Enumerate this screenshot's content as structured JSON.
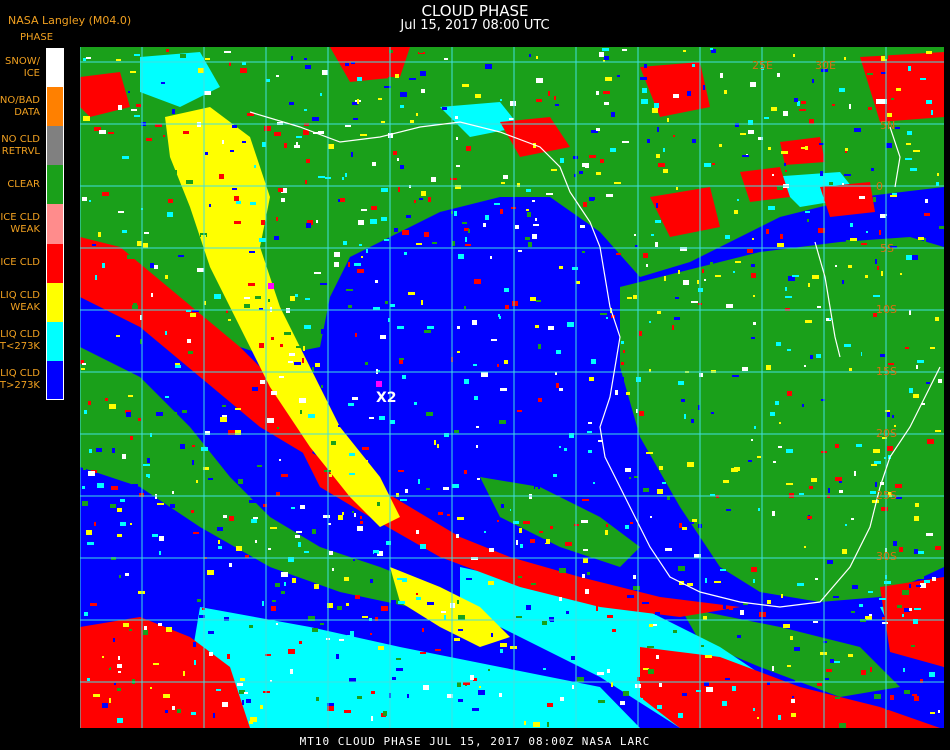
{
  "header": {
    "credit": "NASA Langley (M04.0)",
    "title": "CLOUD PHASE",
    "datetime": "Jul 15, 2017 08:00 UTC"
  },
  "legend": {
    "title": "PHASE",
    "items": [
      {
        "label": "SNOW/\nICE",
        "color": "#ffffff"
      },
      {
        "label": "NO/BAD\nDATA",
        "color": "#ff8000"
      },
      {
        "label": "NO CLD\nRETRVL",
        "color": "#808080"
      },
      {
        "label": "CLEAR",
        "color": "#1aa01a"
      },
      {
        "label": "ICE CLD\nWEAK",
        "color": "#ff8c8c"
      },
      {
        "label": "ICE CLD",
        "color": "#ff0000"
      },
      {
        "label": "LIQ CLD\nWEAK",
        "color": "#ffff00"
      },
      {
        "label": "LIQ CLD\nT<273K",
        "color": "#00ffff"
      },
      {
        "label": "LIQ CLD\nT>273K",
        "color": "#0000ff"
      }
    ]
  },
  "map": {
    "lon_labels_top": [
      "25E",
      "30E"
    ],
    "lat_labels_right": [
      "5N",
      "0",
      "5S",
      "10S",
      "15S",
      "20S",
      "25S",
      "30S"
    ],
    "marker_label": "X2",
    "colors": {
      "ocean": "#0000ff",
      "land": "#1aa01a",
      "grid": "#40e0e0",
      "coast": "#ffffff",
      "marker": "#ff00ff"
    }
  },
  "footer": {
    "text": "MT10   CLOUD PHASE    JUL 15, 2017 08:00Z   NASA LARC"
  }
}
